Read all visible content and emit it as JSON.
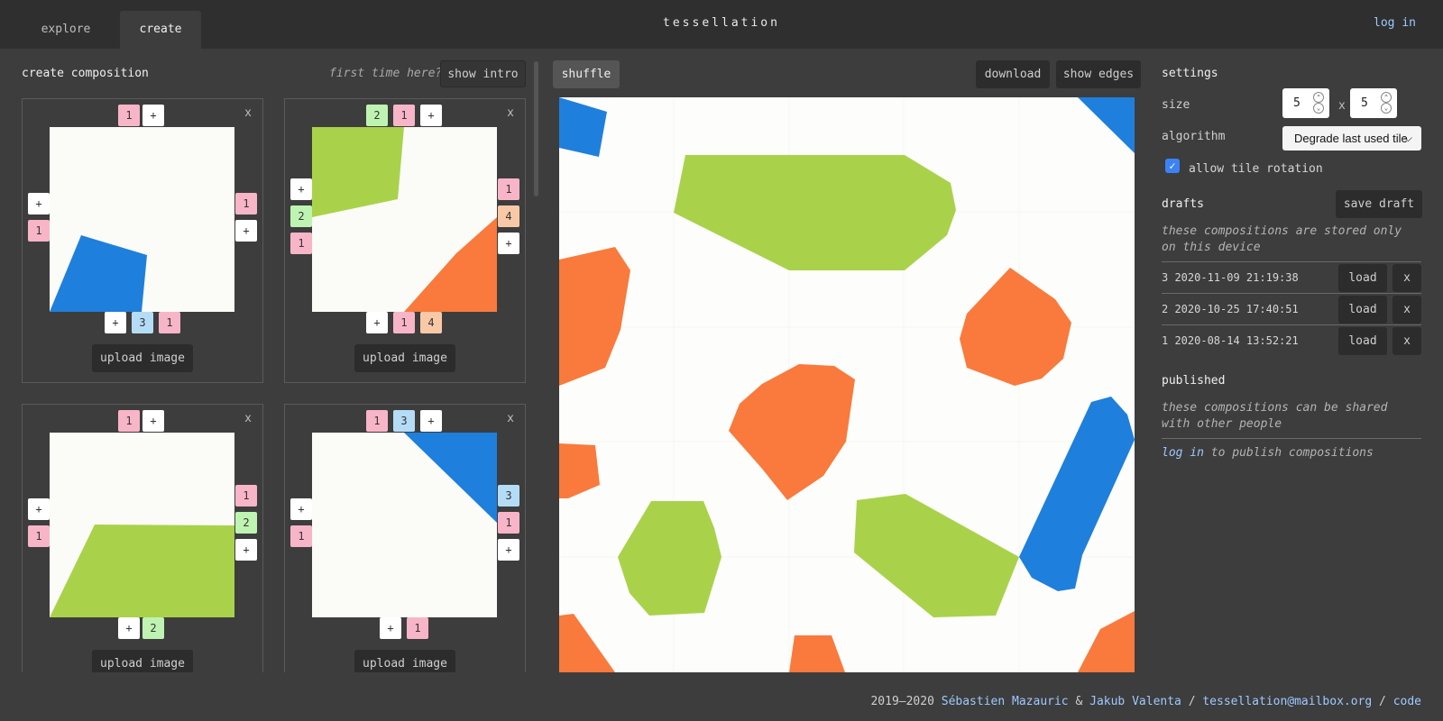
{
  "header": {
    "tabs": [
      {
        "label": "explore"
      },
      {
        "label": "create"
      }
    ],
    "title": "tessellation",
    "login": "log in"
  },
  "left": {
    "title": "create composition",
    "first_time": "first time here?",
    "show_intro": "show intro",
    "close": "x",
    "upload": "upload image",
    "tiles": [
      {
        "top": [
          "1",
          "+"
        ],
        "left": [
          "+",
          "1"
        ],
        "right": [
          "1",
          "+"
        ],
        "bottom": [
          "+",
          "3",
          "1"
        ]
      },
      {
        "top": [
          "2",
          "1",
          "+"
        ],
        "left": [
          "+",
          "2",
          "1"
        ],
        "right": [
          "1",
          "4",
          "+"
        ],
        "bottom": [
          "+",
          "1",
          "4"
        ]
      },
      {
        "top": [
          "1",
          "+"
        ],
        "left": [
          "+",
          "1"
        ],
        "right": [
          "1",
          "2",
          "+"
        ],
        "bottom": [
          "+",
          "2"
        ]
      },
      {
        "top": [
          "1",
          "3",
          "+"
        ],
        "left": [
          "+",
          "1"
        ],
        "right": [
          "3",
          "1",
          "+"
        ],
        "bottom": [
          "+",
          "1"
        ]
      }
    ]
  },
  "center": {
    "shuffle": "shuffle",
    "download": "download",
    "show_edges": "show edges"
  },
  "settings": {
    "heading": "settings",
    "size_label": "size",
    "size_w": "5",
    "size_h": "5",
    "size_sep": "x",
    "algorithm_label": "algorithm",
    "algorithm_value": "Degrade last used tile",
    "rotation_label": "allow tile rotation",
    "rotation_checked": true
  },
  "drafts": {
    "heading": "drafts",
    "save": "save draft",
    "note": "these compositions are stored only on this device",
    "load": "load",
    "delete": "x",
    "items": [
      {
        "label": "3 2020-11-09 21:19:38"
      },
      {
        "label": "2 2020-10-25 17:40:51"
      },
      {
        "label": "1 2020-08-14 13:52:21"
      }
    ]
  },
  "published": {
    "heading": "published",
    "note": "these compositions can be shared with other people",
    "login": "log in",
    "login_suffix": " to publish compositions"
  },
  "footer": {
    "years": "2019–2020 ",
    "author1": "Sébastien Mazauric",
    "amp": " & ",
    "author2": "Jakub Valenta",
    "sep1": " / ",
    "email": "tessellation@mailbox.org",
    "sep2": " / ",
    "code": "code"
  },
  "colors": {
    "background": "#3d3d3d",
    "header": "#2f2f2f",
    "link": "#9ec9ff",
    "tile_blue": "#1f7fdc",
    "tile_green": "#a9d24a",
    "tile_orange": "#f97a3c",
    "edge_pink": "#f8b5c8",
    "edge_green": "#bff3b2",
    "edge_blue": "#b5dcf7",
    "edge_orange": "#f9c9a7"
  }
}
